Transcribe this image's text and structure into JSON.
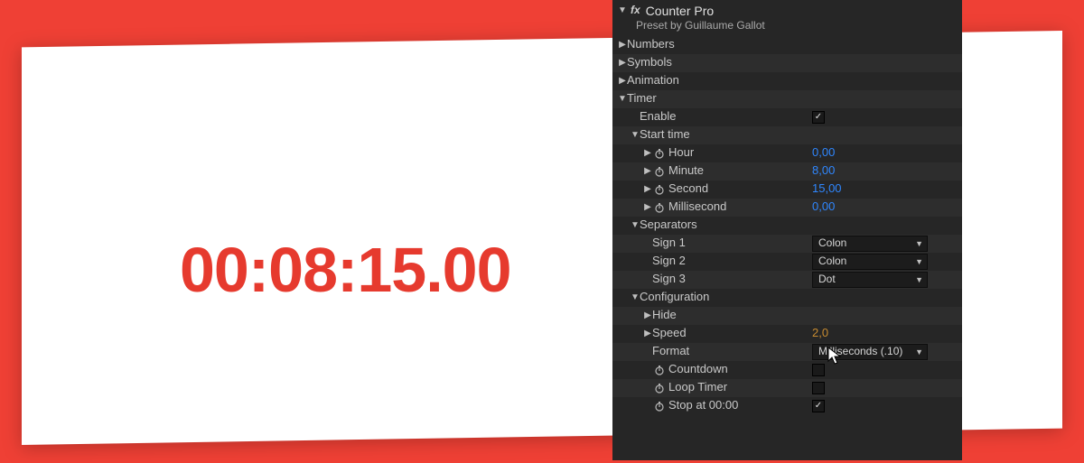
{
  "preview": {
    "timer_text": "00:08:15.00"
  },
  "panel": {
    "fx_prefix": "fx",
    "title": "Counter Pro",
    "subtitle": "Preset by Guillaume Gallot",
    "groups": {
      "numbers": "Numbers",
      "symbols": "Symbols",
      "animation": "Animation",
      "timer": "Timer"
    },
    "timer": {
      "enable_label": "Enable",
      "enable_checked": "✓",
      "start_time_label": "Start time",
      "hour": {
        "label": "Hour",
        "value": "0,00"
      },
      "minute": {
        "label": "Minute",
        "value": "8,00"
      },
      "second": {
        "label": "Second",
        "value": "15,00"
      },
      "millisecond": {
        "label": "Millisecond",
        "value": "0,00"
      },
      "separators_label": "Separators",
      "sign1": {
        "label": "Sign 1",
        "value": "Colon"
      },
      "sign2": {
        "label": "Sign 2",
        "value": "Colon"
      },
      "sign3": {
        "label": "Sign 3",
        "value": "Dot"
      },
      "config_label": "Configuration",
      "hide_label": "Hide",
      "speed": {
        "label": "Speed",
        "value": "2,0"
      },
      "format": {
        "label": "Format",
        "value": "Milliseconds (.10)"
      },
      "countdown_label": "Countdown",
      "loop_label": "Loop Timer",
      "stop_label": "Stop at 00:00",
      "stop_checked": "✓"
    }
  }
}
